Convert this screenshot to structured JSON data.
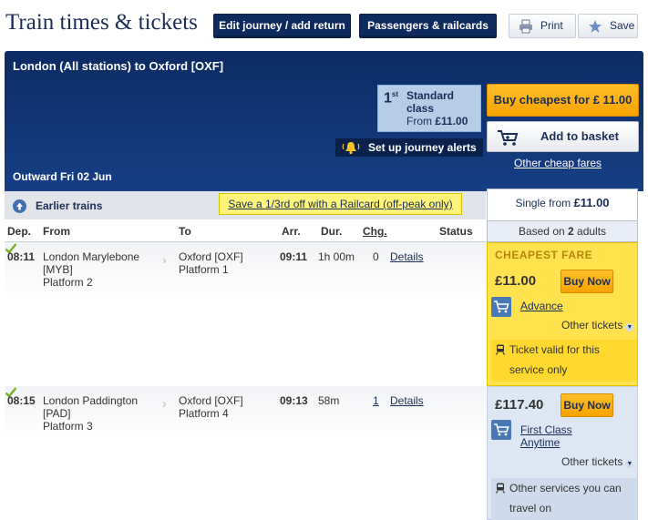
{
  "header": {
    "title": "Train times & tickets",
    "edit_journey_label": "Edit journey / add return",
    "passengers_label": "Passengers & railcards",
    "print_label": "Print",
    "save_label": "Save"
  },
  "journey": {
    "route": "London (All stations) to Oxford [OXF]",
    "outward": "Outward Fri 02 Jun",
    "class_num": "1",
    "class_sup": "st",
    "class_name": "Standard class",
    "class_from_prefix": "From ",
    "class_from_price": "£11.00",
    "alerts_label": "Set up journey alerts",
    "buy_cheapest_label": "Buy cheapest for £ 11.00",
    "add_basket_label": "Add to basket",
    "other_fares_label": "Other cheap fares"
  },
  "list": {
    "earlier_label": "Earlier trains",
    "railcard_promo": "Save a 1/3rd off with a Railcard (off-peak only)",
    "single_prefix": "Single from ",
    "single_price": "£11.00",
    "adults_prefix": "Based on ",
    "adults_count": "2",
    "adults_suffix": " adults",
    "columns": [
      "Dep.",
      "From",
      "To",
      "Arr.",
      "Dur.",
      "Chg.",
      "Status"
    ]
  },
  "services": [
    {
      "dep": "08:11",
      "from_station": "London Marylebone",
      "from_code": "[MYB]",
      "from_platform": "Platform 2",
      "to_station": "Oxford [OXF]",
      "to_platform": "Platform 1",
      "arr": "09:11",
      "dur": "1h 00m",
      "chg": "0",
      "details": "Details",
      "fare": {
        "label": "CHEAPEST FARE",
        "price": "£11.00",
        "buy": "Buy Now",
        "type": "Advance",
        "other": "Other tickets",
        "note": "Ticket valid for this service only"
      }
    },
    {
      "dep": "08:15",
      "from_station": "London Paddington",
      "from_code": "[PAD]",
      "from_platform": "Platform 3",
      "to_station": "Oxford [OXF]",
      "to_platform": "Platform 4",
      "arr": "09:13",
      "dur": "58m",
      "chg": "1",
      "details": "Details",
      "fare": {
        "price": "£117.40",
        "buy": "Buy Now",
        "type": "First Class Anytime",
        "other": "Other tickets",
        "note": "Other services you can travel on"
      }
    }
  ],
  "colors": {
    "navy": "#0f2a5c",
    "orange": "#f7a300",
    "cheapest_yellow": "#ffe24d",
    "status_green": "#7ab02a"
  },
  "icons": [
    "printer-icon",
    "star-icon",
    "bell-icon",
    "basket-icon",
    "up-arrow-icon",
    "chevron-icon",
    "tick-icon",
    "cart-icon",
    "train-icon"
  ]
}
